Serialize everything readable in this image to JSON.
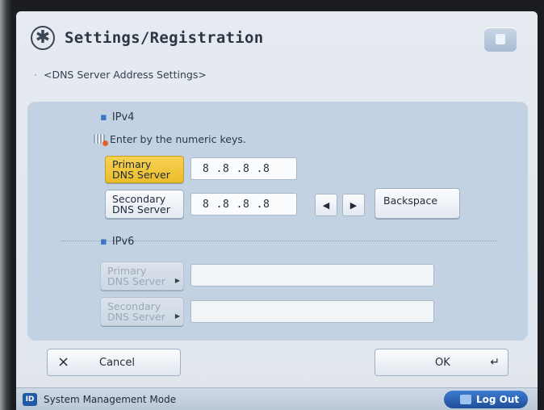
{
  "header": {
    "title": "Settings/Registration",
    "subtitle": "<DNS Server Address Settings>"
  },
  "ipv4": {
    "label": "IPv4",
    "hint": "Enter by the numeric keys.",
    "primary": {
      "label_line1": "Primary",
      "label_line2": "DNS Server",
      "value": "8 .8 .8 .8"
    },
    "secondary": {
      "label_line1": "Secondary",
      "label_line2": "DNS Server",
      "value": "8 .8 .8 .8"
    }
  },
  "ipv6": {
    "label": "IPv6",
    "primary": {
      "label_line1": "Primary",
      "label_line2": "DNS Server",
      "value": ""
    },
    "secondary": {
      "label_line1": "Secondary",
      "label_line2": "DNS Server",
      "value": ""
    }
  },
  "controls": {
    "left_arrow": "◀",
    "right_arrow": "▶",
    "backspace": "Backspace"
  },
  "footer": {
    "cancel_icon": "×",
    "cancel": "Cancel",
    "ok": "OK",
    "ok_icon": "↵"
  },
  "status": {
    "icon_text": "ID",
    "mode": "System Management Mode",
    "logout": "Log Out"
  },
  "icons": {
    "title": "settings-star-icon",
    "kbd": "numeric-keys-icon",
    "logout": "logout-icon"
  },
  "colors": {
    "active_button": "#f0c844",
    "panel": "#c3d2e2",
    "accent": "#1f4f98"
  }
}
